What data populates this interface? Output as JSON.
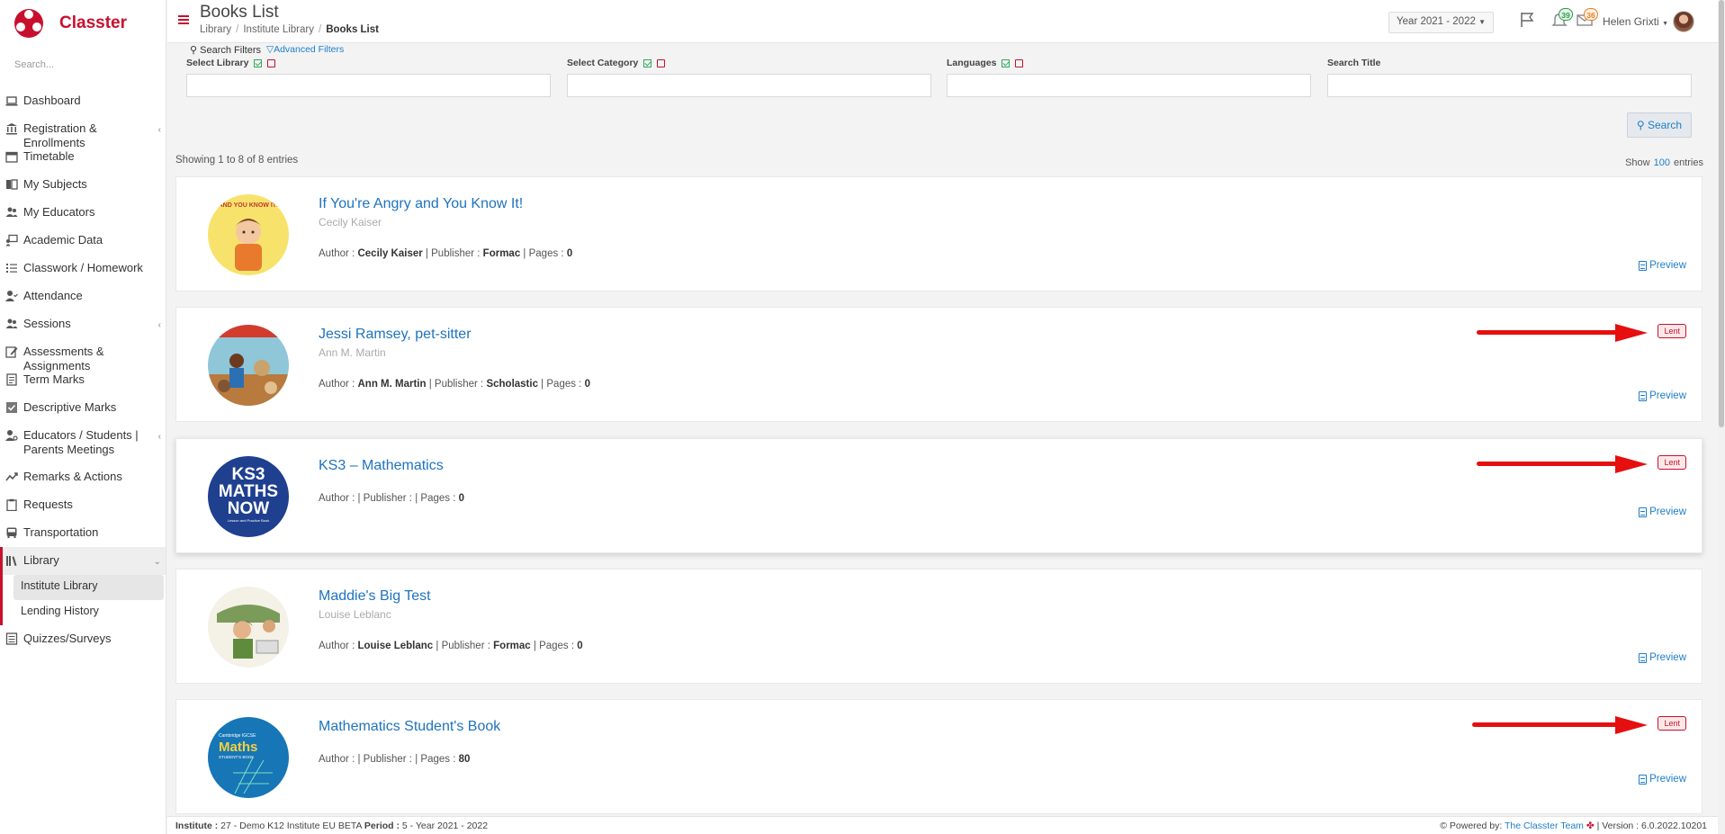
{
  "app": {
    "name": "Classter"
  },
  "sidebar": {
    "search_placeholder": "Search...",
    "items": [
      {
        "label": "Dashboard"
      },
      {
        "label": "Registration & Enrollments"
      },
      {
        "label": "Timetable"
      },
      {
        "label": "My Subjects"
      },
      {
        "label": "My Educators"
      },
      {
        "label": "Academic Data"
      },
      {
        "label": "Classwork / Homework"
      },
      {
        "label": "Attendance"
      },
      {
        "label": "Sessions"
      },
      {
        "label": "Assessments & Assignments"
      },
      {
        "label": "Term Marks"
      },
      {
        "label": "Descriptive Marks"
      },
      {
        "label": "Educators / Students | Parents Meetings"
      },
      {
        "label": "Remarks & Actions"
      },
      {
        "label": "Requests"
      },
      {
        "label": "Transportation"
      },
      {
        "label": "Library"
      },
      {
        "label": "Quizzes/Surveys"
      }
    ],
    "library_sub": [
      {
        "label": "Institute Library"
      },
      {
        "label": "Lending History"
      }
    ]
  },
  "header": {
    "title": "Books List",
    "breadcrumbs": [
      "Library",
      "Institute Library",
      "Books List"
    ],
    "year": "Year 2021 - 2022",
    "notif_count": "39",
    "msg_count": "36",
    "user": "Helen Grixti"
  },
  "filters": {
    "search_tab": "Search Filters",
    "advanced_tab": "Advanced Filters",
    "library_label": "Select Library",
    "category_label": "Select Category",
    "languages_label": "Languages",
    "title_label": "Search Title",
    "search_button": "Search"
  },
  "list": {
    "showing": "Showing 1 to 8 of 8 entries",
    "show_label": "Show",
    "show_count": "100",
    "entries_label": "entries"
  },
  "books": [
    {
      "title": "If You're Angry and You Know It!",
      "subtitle_author": "Cecily Kaiser",
      "author": "Cecily Kaiser",
      "publisher": "Formac",
      "pages": "0",
      "lent": false
    },
    {
      "title": "Jessi Ramsey, pet-sitter",
      "subtitle_author": "Ann M. Martin",
      "author": "Ann M. Martin",
      "publisher": "Scholastic",
      "pages": "0",
      "lent": true
    },
    {
      "title": "KS3 – Mathematics",
      "subtitle_author": "",
      "author": "",
      "publisher": "",
      "pages": "0",
      "lent": true
    },
    {
      "title": "Maddie's Big Test",
      "subtitle_author": "Louise Leblanc",
      "author": "Louise Leblanc",
      "publisher": "Formac",
      "pages": "0",
      "lent": false
    },
    {
      "title": "Mathematics Student's Book",
      "subtitle_author": "",
      "author": "",
      "publisher": "",
      "pages": "80",
      "lent": true
    }
  ],
  "labels": {
    "author": "Author :",
    "publisher": "Publisher :",
    "pages": "Pages :",
    "preview": "Preview",
    "lent": "Lent"
  },
  "cover_text": {
    "book1": "AND YOU KNOW IT!",
    "book3_line1": "KS3",
    "book3_line2": "MATHS",
    "book3_line3": "NOW",
    "book3_small": "Lesson and Practice Book",
    "book5_line1": "Cambridge IGCSE",
    "book5_line2": "Maths",
    "book5_small": "STUDENT'S BOOK"
  },
  "footer": {
    "institute_label": "Institute :",
    "institute_value": "27 - Demo K12 Institute EU BETA",
    "period_label": "Period :",
    "period_value": "5 - Year 2021 - 2022",
    "powered_label": "Powered by:",
    "team": "The Classter Team",
    "version": "| Version : 6.0.2022.10201"
  },
  "colors": {
    "brand": "#c8102e",
    "link": "#1e73be",
    "arrow": "#e50f0f"
  }
}
